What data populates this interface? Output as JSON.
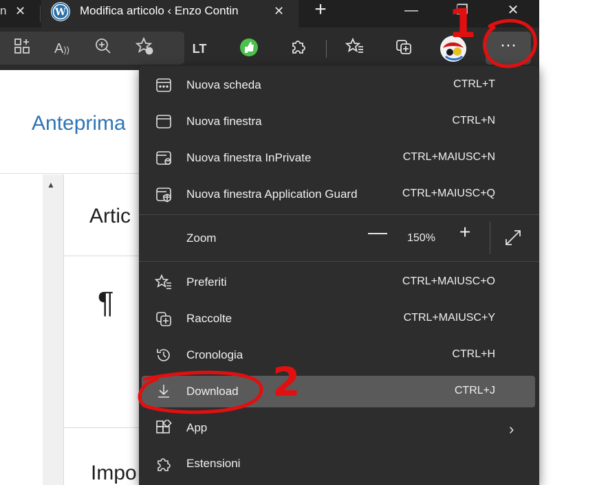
{
  "titlebar": {
    "prev_tab_fragment": "n",
    "active_tab_title": "Modifica articolo ‹ Enzo Contin",
    "close_glyph": "✕",
    "new_tab_glyph": "+",
    "minimize_glyph": "—",
    "restore_glyph": "❐",
    "window_close_glyph": "✕"
  },
  "toolbar": {
    "more_glyph": "···"
  },
  "page": {
    "preview_link": "Anteprima",
    "heading_fragment": "Artic",
    "pilcrow": "¶",
    "section_fragment": "Impo"
  },
  "menu": {
    "items": [
      {
        "label": "Nuova scheda",
        "shortcut": "CTRL+T"
      },
      {
        "label": "Nuova finestra",
        "shortcut": "CTRL+N"
      },
      {
        "label": "Nuova finestra InPrivate",
        "shortcut": "CTRL+MAIUSC+N"
      },
      {
        "label": "Nuova finestra Application Guard",
        "shortcut": "CTRL+MAIUSC+Q"
      },
      {
        "label": "Zoom",
        "shortcut": ""
      },
      {
        "label": "Preferiti",
        "shortcut": "CTRL+MAIUSC+O"
      },
      {
        "label": "Raccolte",
        "shortcut": "CTRL+MAIUSC+Y"
      },
      {
        "label": "Cronologia",
        "shortcut": "CTRL+H"
      },
      {
        "label": "Download",
        "shortcut": "CTRL+J"
      },
      {
        "label": "App",
        "shortcut": ""
      },
      {
        "label": "Estensioni",
        "shortcut": ""
      }
    ],
    "zoom_value": "150%",
    "zoom_minus": "—",
    "zoom_plus": "+"
  },
  "annotations": {
    "step1": "1",
    "step2": "2",
    "color": "#e01010"
  }
}
